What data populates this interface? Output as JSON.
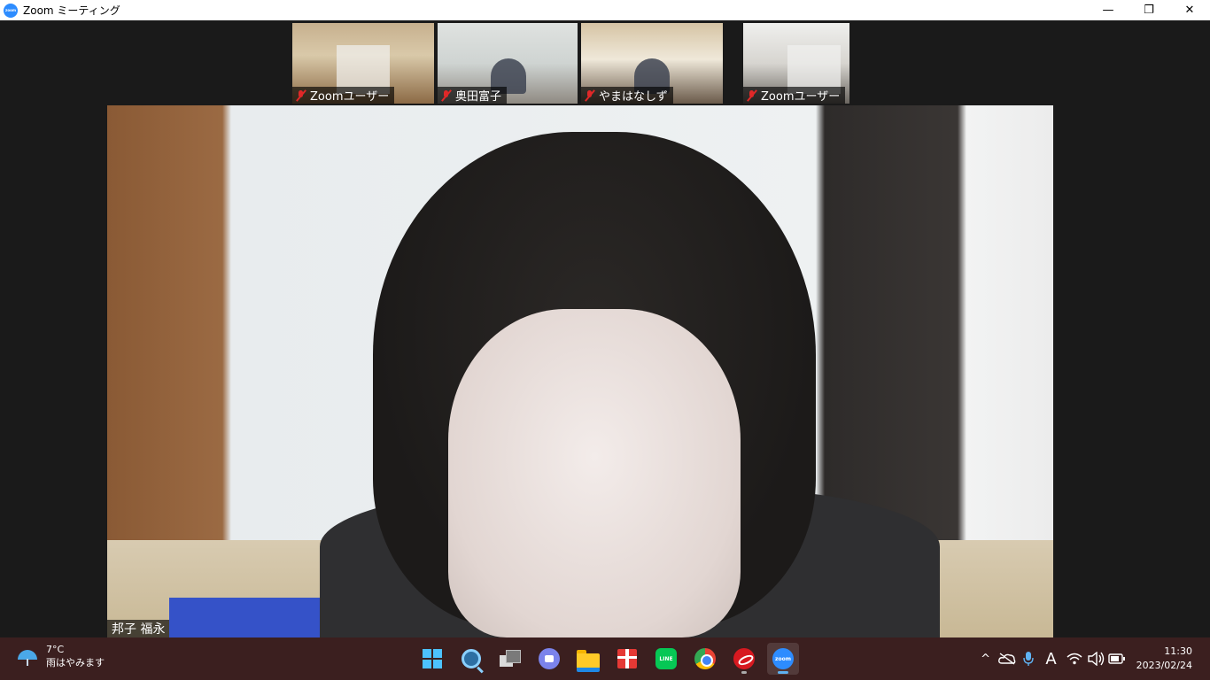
{
  "window": {
    "title": "Zoom ミーティング",
    "logo_text": "zoom",
    "controls": {
      "minimize": "—",
      "restore": "❐",
      "close": "✕"
    }
  },
  "thumbnails": [
    {
      "name": "Zoomユーザー",
      "muted": true
    },
    {
      "name": "奥田富子",
      "muted": true
    },
    {
      "name": "やまはなしず",
      "muted": true
    },
    {
      "name": "Zoomユーザー",
      "muted": true
    }
  ],
  "main_video": {
    "name": "邦子 福永"
  },
  "taskbar": {
    "weather": {
      "temp": "7°C",
      "condition": "雨はやみます",
      "icon": "umbrella-icon"
    },
    "apps": [
      {
        "name": "start",
        "icon": "windows-icon"
      },
      {
        "name": "search",
        "icon": "search-icon"
      },
      {
        "name": "task-view",
        "icon": "task-view-icon"
      },
      {
        "name": "chat",
        "icon": "chat-icon"
      },
      {
        "name": "file-explorer",
        "icon": "folder-icon"
      },
      {
        "name": "gift",
        "icon": "gift-icon"
      },
      {
        "name": "line",
        "icon": "line-icon",
        "label": "LINE"
      },
      {
        "name": "chrome",
        "icon": "chrome-icon"
      },
      {
        "name": "trend-micro",
        "icon": "trend-micro-icon"
      },
      {
        "name": "zoom",
        "icon": "zoom-icon",
        "label": "zoom",
        "active": true
      }
    ],
    "tray": {
      "chevron": "^",
      "ime": "A",
      "clock": {
        "time": "11:30",
        "date": "2023/02/24"
      }
    }
  },
  "colors": {
    "zoom_blue": "#2d8cff",
    "muted_red": "#e02828",
    "taskbar_bg": "#3b1f1f"
  }
}
